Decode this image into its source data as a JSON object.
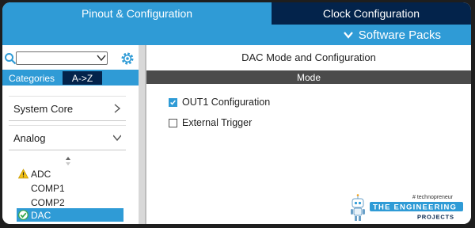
{
  "tabs": {
    "pinout": "Pinout & Configuration",
    "clock": "Clock Configuration"
  },
  "toolbar": {
    "software_packs": "Software Packs"
  },
  "sidebar": {
    "search_value": "",
    "tab_categories": "Categories",
    "tab_az": "A->Z",
    "groups": {
      "system_core": "System Core",
      "analog": "Analog"
    },
    "peripherals": [
      {
        "label": "ADC",
        "status": "warning"
      },
      {
        "label": "COMP1",
        "status": "none"
      },
      {
        "label": "COMP2",
        "status": "none"
      },
      {
        "label": "DAC",
        "status": "ok",
        "selected": true
      }
    ]
  },
  "main": {
    "title": "DAC Mode and Configuration",
    "mode_header": "Mode",
    "options": [
      {
        "label": "OUT1 Configuration",
        "checked": true
      },
      {
        "label": "External Trigger",
        "checked": false
      }
    ]
  },
  "watermark": {
    "tagline": "# technopreneur",
    "line1": "THE ENGINEERING",
    "line2": "PROJECTS"
  },
  "colors": {
    "accent": "#2f9bd6",
    "navy": "#03234b",
    "mode_bar": "#4b4b4b"
  }
}
